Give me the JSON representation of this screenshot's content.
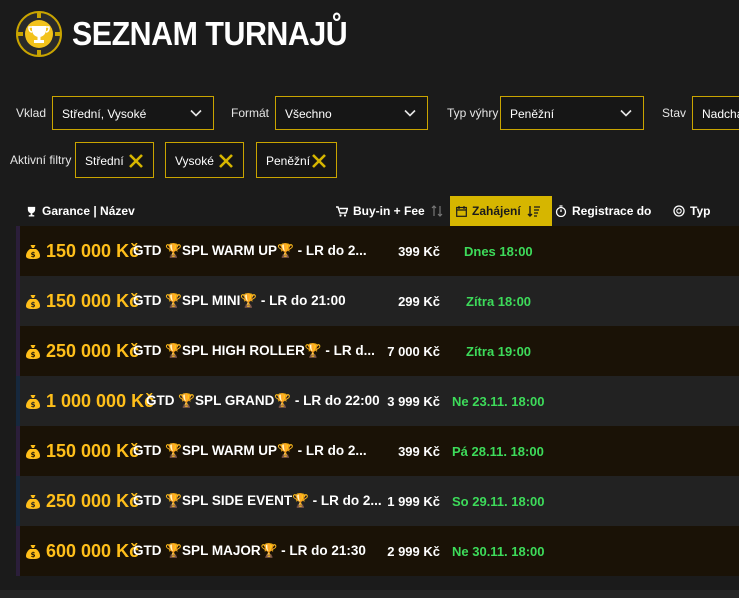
{
  "header": {
    "title": "SEZNAM TURNAJŮ",
    "logo_icon": "trophy-chip-icon"
  },
  "filters": {
    "deposit": {
      "label": "Vklad",
      "value": "Střední, Vysoké"
    },
    "format": {
      "label": "Formát",
      "value": "Všechno"
    },
    "win_type": {
      "label": "Typ výhry",
      "value": "Peněžní"
    },
    "status": {
      "label": "Stav",
      "value": "Nadcház"
    }
  },
  "active_filters": {
    "label": "Aktivní filtry",
    "chips": [
      "Střední",
      "Vysoké",
      "Peněžní"
    ]
  },
  "table": {
    "columns": {
      "name": "Garance | Název",
      "buyin": "Buy-in + Fee",
      "start": "Zahájení",
      "registration": "Registrace do",
      "type": "Typ"
    },
    "rows": [
      {
        "amount": "150 000 Kč",
        "name": "GTD 🏆SPL WARM UP🏆 - LR do 2...",
        "buyin": "399 Kč",
        "start": "Dnes 18:00"
      },
      {
        "amount": "150 000 Kč",
        "name": "GTD 🏆SPL MINI🏆 - LR do 21:00",
        "buyin": "299 Kč",
        "start": "Zítra 18:00"
      },
      {
        "amount": "250 000 Kč",
        "name": "GTD 🏆SPL HIGH ROLLER🏆 - LR d...",
        "buyin": "7 000 Kč",
        "start": "Zítra 19:00"
      },
      {
        "amount": "1 000 000 Kč",
        "name": "GTD 🏆SPL GRAND🏆 - LR do 22:00",
        "buyin": "3 999 Kč",
        "start": "Ne 23.11. 18:00"
      },
      {
        "amount": "150 000 Kč",
        "name": "GTD 🏆SPL WARM UP🏆 - LR do 2...",
        "buyin": "399 Kč",
        "start": "Pá 28.11. 18:00"
      },
      {
        "amount": "250 000 Kč",
        "name": "GTD 🏆SPL SIDE EVENT🏆 - LR do 2...",
        "buyin": "1 999 Kč",
        "start": "So 29.11. 18:00"
      },
      {
        "amount": "600 000 Kč",
        "name": "GTD 🏆SPL MAJOR🏆 - LR do 21:30",
        "buyin": "2 999 Kč",
        "start": "Ne 30.11. 18:00"
      }
    ]
  },
  "colors": {
    "accent": "#d6b600",
    "amount": "#ffbf1a",
    "start": "#3ddb5a",
    "background": "#1b1b1b"
  }
}
